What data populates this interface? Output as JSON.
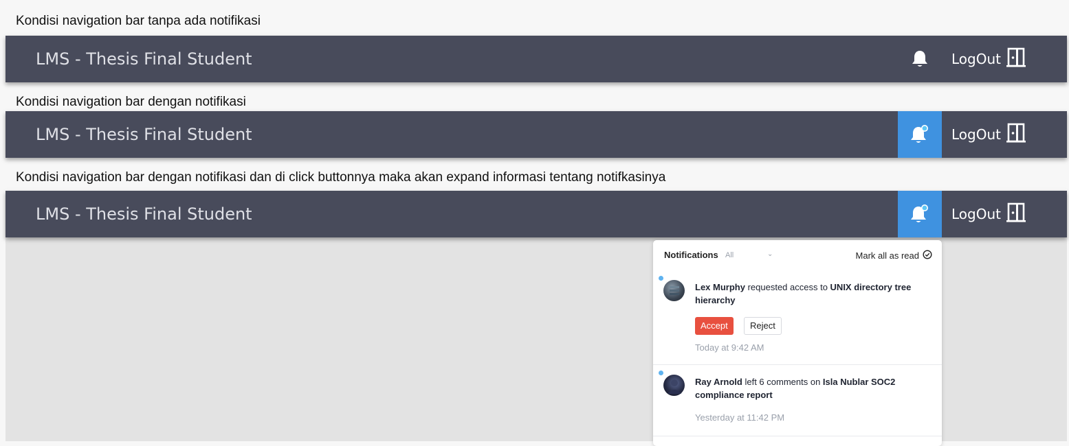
{
  "captions": {
    "first": "Kondisi navigation bar tanpa ada notifikasi",
    "second": "Kondisi navigation bar dengan notifikasi",
    "third": "Kondisi navigation bar dengan notifikasi dan di click buttonnya maka akan expand informasi tentang notifkasinya"
  },
  "navbar": {
    "title": "LMS - Thesis Final Student",
    "logout_label": "LogOut",
    "bell_active_color": "#3f92e0",
    "background_color": "#484b5b"
  },
  "notifications_panel": {
    "title": "Notifications",
    "filter": "All",
    "mark_all_label": "Mark all as read",
    "items": [
      {
        "actor": "Lex Murphy",
        "action": " requested access to ",
        "target": "UNIX directory tree hierarchy",
        "accept_label": "Accept",
        "reject_label": "Reject",
        "time": "Today at 9:42 AM"
      },
      {
        "actor": "Ray Arnold",
        "action": " left 6 comments on ",
        "target": "Isla Nublar SOC2 compliance report",
        "time": "Yesterday at 11:42 PM"
      }
    ]
  }
}
